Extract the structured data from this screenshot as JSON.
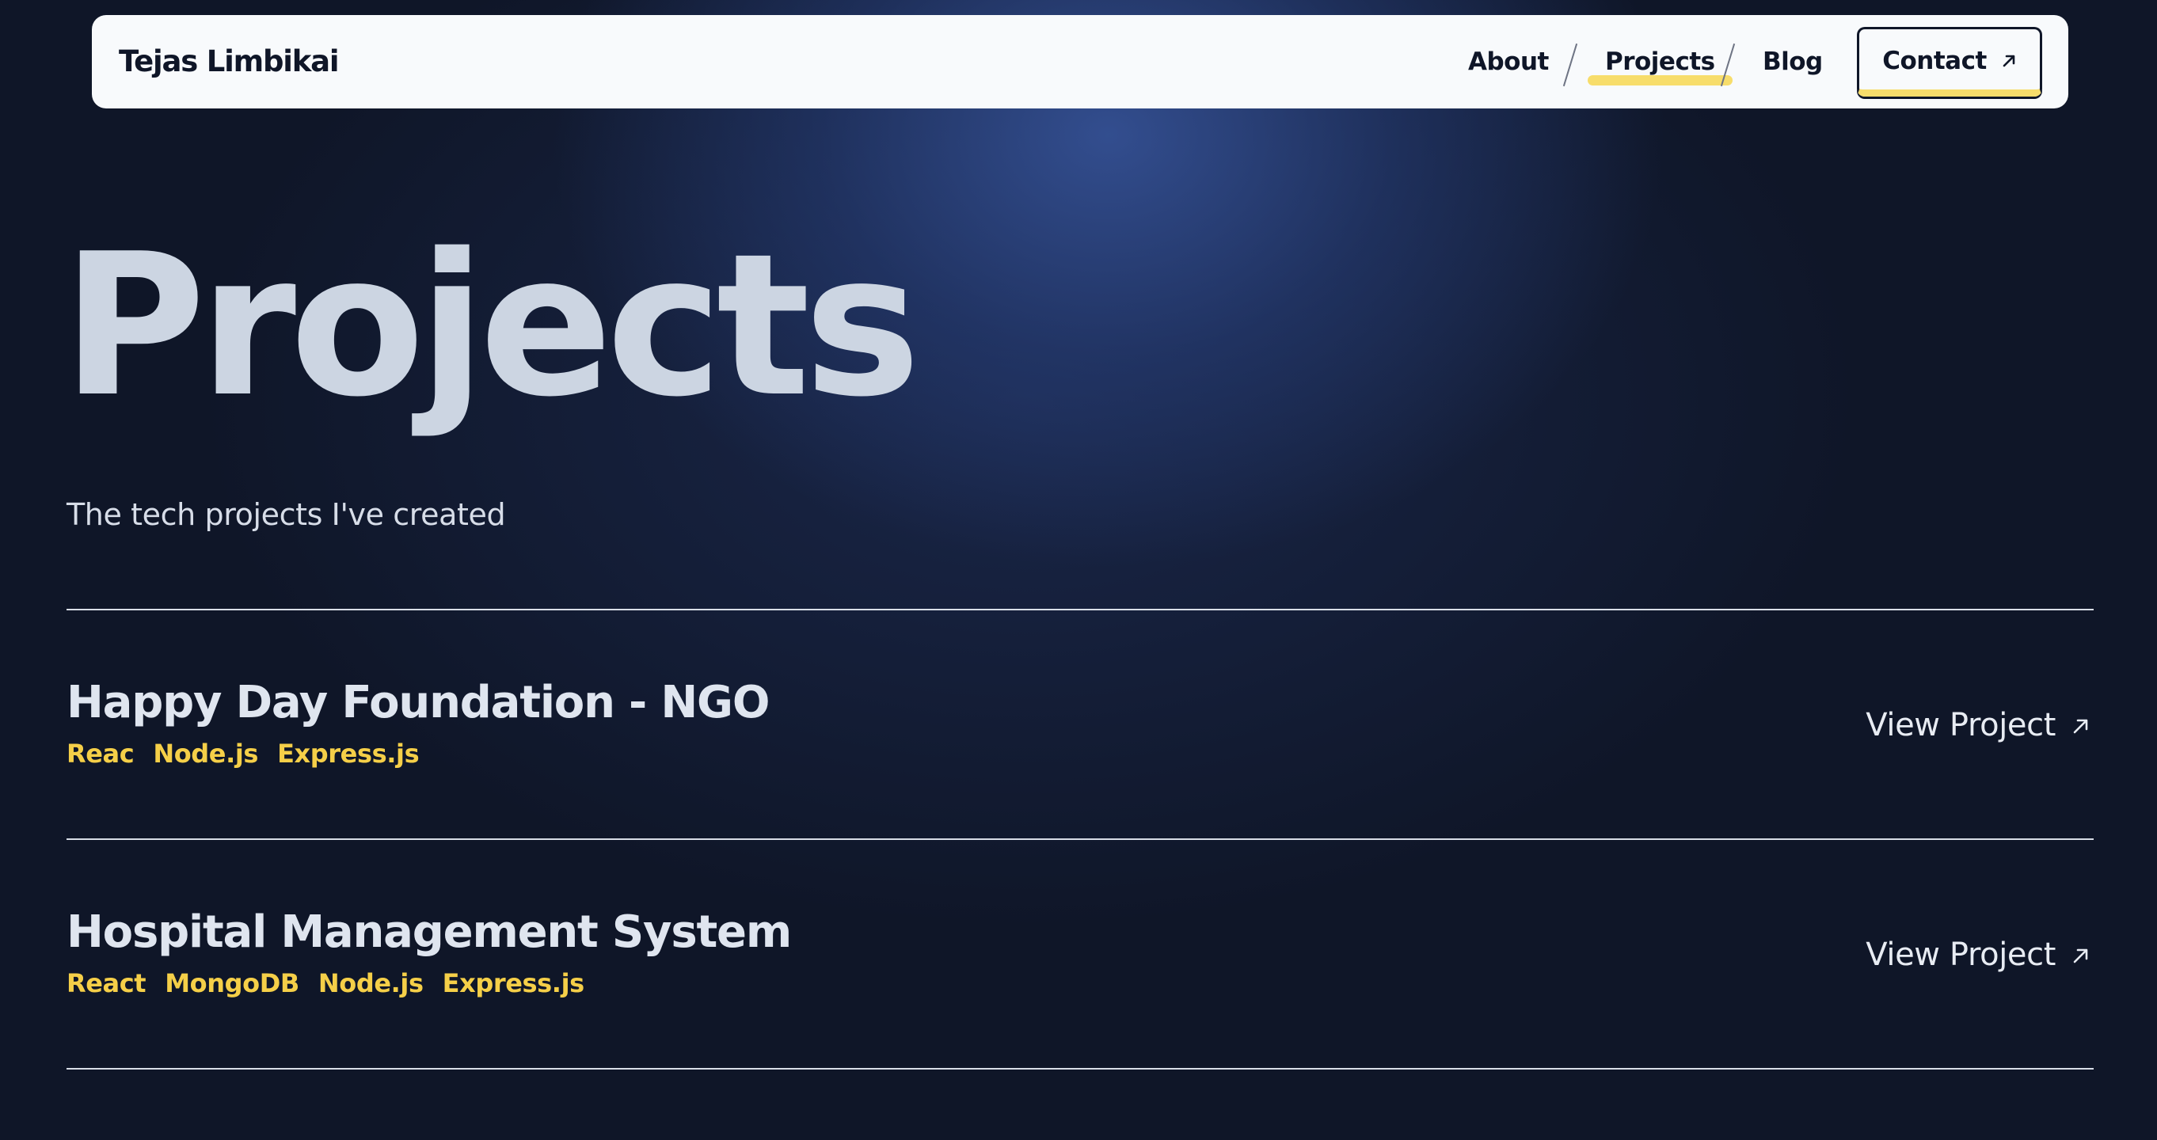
{
  "navbar": {
    "brand": "Tejas Limbikai",
    "links": [
      {
        "label": "About"
      },
      {
        "label": "Projects",
        "active": true
      },
      {
        "label": "Blog"
      }
    ],
    "contact_label": "Contact",
    "contact_icon": "arrow-up-right-icon",
    "accent_color": "#f7dd6b"
  },
  "hero": {
    "title": "Projects",
    "subtitle": "The tech projects I've created"
  },
  "projects": [
    {
      "title": "Happy Day Foundation - NGO",
      "tags": [
        "Reac",
        "Node.js",
        "Express.js"
      ],
      "link_label": "View Project",
      "link_icon": "arrow-up-right-icon"
    },
    {
      "title": "Hospital Management System",
      "tags": [
        "React",
        "MongoDB",
        "Node.js",
        "Express.js"
      ],
      "link_label": "View Project",
      "link_icon": "arrow-up-right-icon"
    }
  ],
  "colors": {
    "background": "#0f1628",
    "glow": "#38569e",
    "tag": "#f5cf48",
    "heading": "#ccd5e2"
  }
}
